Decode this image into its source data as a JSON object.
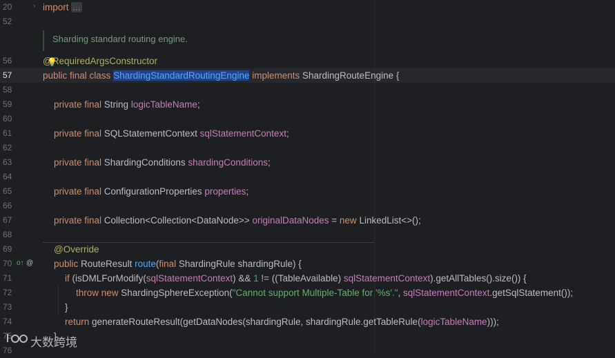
{
  "gutter": {
    "line_numbers": [
      "20",
      "52",
      "56",
      "57",
      "58",
      "59",
      "60",
      "61",
      "62",
      "63",
      "64",
      "65",
      "66",
      "67",
      "68",
      "69",
      "70",
      "71",
      "72",
      "73",
      "74",
      "75",
      "76"
    ],
    "current_line": "57"
  },
  "doc_comment": "Sharding standard routing engine.",
  "code": {
    "import_kw": "import",
    "import_fold": "...",
    "annotation_class": "@RequiredArgsConstructor",
    "class_decl": {
      "kw": "public final class ",
      "name": "ShardingStandardRoutingEngine",
      "impl": " implements ",
      "iface": "ShardingRouteEngine {"
    },
    "fields": [
      {
        "kw": "private final ",
        "type": "String ",
        "name": "logicTableName",
        "end": ";"
      },
      {
        "kw": "private final ",
        "type": "SQLStatementContext ",
        "name": "sqlStatementContext",
        "end": ";"
      },
      {
        "kw": "private final ",
        "type": "ShardingConditions ",
        "name": "shardingConditions",
        "end": ";"
      },
      {
        "kw": "private final ",
        "type": "ConfigurationProperties ",
        "name": "properties",
        "end": ";"
      }
    ],
    "field_collection": {
      "kw": "private final ",
      "type": "Collection<Collection<DataNode>> ",
      "name": "originalDataNodes",
      "mid": " = ",
      "new_kw": "new ",
      "rest": "LinkedList<>();"
    },
    "override": "@Override",
    "method": {
      "kw": "public ",
      "type": "RouteResult ",
      "name": "route",
      "p1": "(",
      "final_kw": "final ",
      "params": "ShardingRule shardingRule) {"
    },
    "if_line": {
      "kw": "if ",
      "a": "(isDMLForModify(",
      "f1": "sqlStatementContext",
      "b": ") && ",
      "num": "1",
      "c": " != ((TableAvailable) ",
      "f2": "sqlStatementContext",
      "d": ").getAllTables().size()) {"
    },
    "throw_line": {
      "kw": "throw new ",
      "cls": "ShardingSphereException(",
      "str": "\"Cannot support Multiple-Table for '%s'.\"",
      "mid": ", ",
      "f": "sqlStatementContext",
      "end": ".getSqlStatement());"
    },
    "close_brace": "}",
    "return_line": {
      "kw": "return ",
      "a": "generateRouteResult(getDataNodes(shardingRule, shardingRule.getTableRule(",
      "f": "logicTableName",
      "end": ")));"
    },
    "last_brace": "}"
  },
  "watermark": "大数跨境"
}
